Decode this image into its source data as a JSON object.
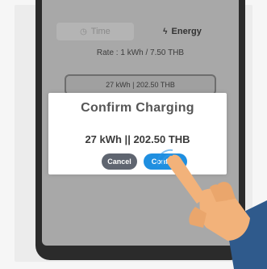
{
  "app": {
    "tabs": [
      {
        "label": "Time",
        "icon": "clock-icon",
        "active": false
      },
      {
        "label": "Energy",
        "icon": "lightning-icon",
        "active": true
      }
    ],
    "rate_text": "Rate : 1 kWh / 7.50 THB",
    "selection_text": "27 kWh | 202.50 THB"
  },
  "dialog": {
    "title": "Confirm Charging",
    "message": "27 kWh || 202.50 THB",
    "cancel_label": "Cancel",
    "confirm_label": "Confirm"
  },
  "colors": {
    "confirm": "#1f8fe0",
    "cancel": "#5f6570",
    "hand_skin": "#f2b27a",
    "sleeve": "#2f5a8c"
  }
}
